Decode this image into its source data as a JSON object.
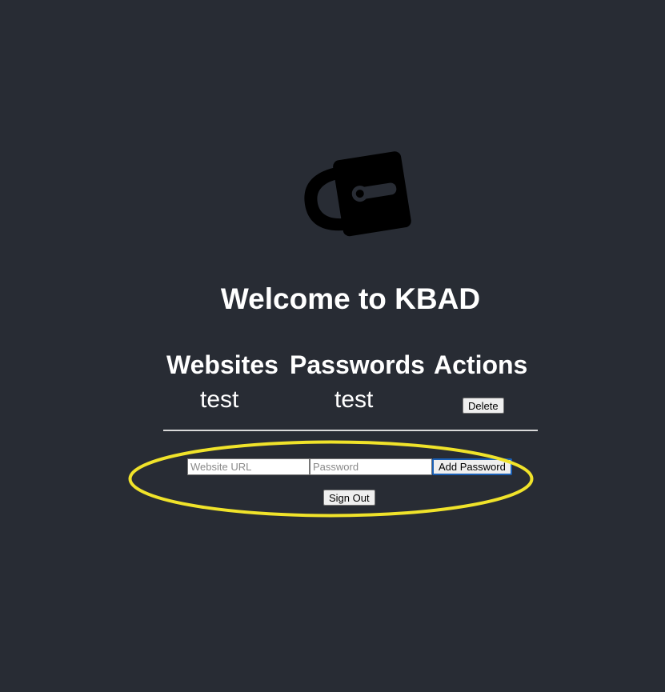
{
  "colors": {
    "background": "#282c34",
    "text": "#ffffff",
    "highlight": "#f0e32a",
    "divider": "#d9d9d9"
  },
  "header": {
    "logo_icon": "padlock-icon",
    "title": "Welcome to KBAD"
  },
  "table": {
    "columns": [
      "Websites",
      "Passwords",
      "Actions"
    ],
    "rows": [
      {
        "website": "test",
        "password": "test",
        "action_label": "Delete"
      }
    ]
  },
  "form": {
    "website_placeholder": "Website URL",
    "password_placeholder": "Password",
    "website_value": "",
    "password_value": "",
    "add_label": "Add Password"
  },
  "signout_label": "Sign Out"
}
